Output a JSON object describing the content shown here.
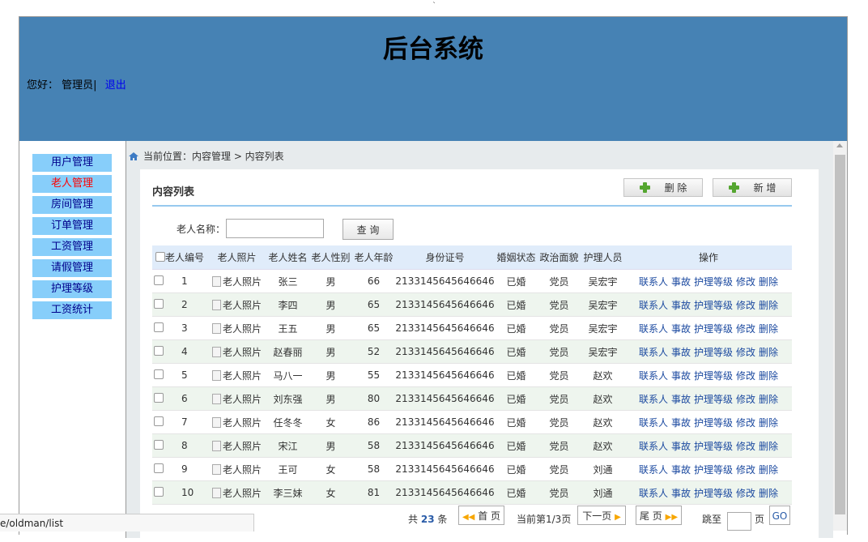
{
  "window_tick": "`",
  "header": {
    "title": "后台系统",
    "greeting": "您好：",
    "user": "管理员|",
    "logout": "退出"
  },
  "sidebar": {
    "items": [
      {
        "label": "用户管理",
        "active": false
      },
      {
        "label": "老人管理",
        "active": true
      },
      {
        "label": "房间管理",
        "active": false
      },
      {
        "label": "订单管理",
        "active": false
      },
      {
        "label": "工资管理",
        "active": false
      },
      {
        "label": "请假管理",
        "active": false
      },
      {
        "label": "护理等级",
        "active": false
      },
      {
        "label": "工资统计",
        "active": false
      }
    ]
  },
  "breadcrumb": "当前位置：内容管理 > 内容列表",
  "panel": {
    "title": "内容列表",
    "delete_label": "删 除",
    "add_label": "新 增"
  },
  "search": {
    "label": "老人名称：",
    "value": "",
    "button": "查 询"
  },
  "table": {
    "headers": [
      "老人编号",
      "老人照片",
      "老人姓名",
      "老人性别",
      "老人年龄",
      "身份证号",
      "婚姻状态",
      "政治面貌",
      "护理人员",
      "操作"
    ],
    "photo_alt": "老人照片",
    "actions": [
      "联系人",
      "事故",
      "护理等级",
      "修改",
      "删除"
    ],
    "rows": [
      {
        "id": "1",
        "name": "张三",
        "gender": "男",
        "age": "66",
        "idcard": "2133145645646646",
        "marital": "已婚",
        "political": "党员",
        "nurse": "吴宏宇"
      },
      {
        "id": "2",
        "name": "李四",
        "gender": "男",
        "age": "65",
        "idcard": "2133145645646646",
        "marital": "已婚",
        "political": "党员",
        "nurse": "吴宏宇"
      },
      {
        "id": "3",
        "name": "王五",
        "gender": "男",
        "age": "65",
        "idcard": "2133145645646646",
        "marital": "已婚",
        "political": "党员",
        "nurse": "吴宏宇"
      },
      {
        "id": "4",
        "name": "赵春丽",
        "gender": "男",
        "age": "52",
        "idcard": "2133145645646646",
        "marital": "已婚",
        "political": "党员",
        "nurse": "吴宏宇"
      },
      {
        "id": "5",
        "name": "马八一",
        "gender": "男",
        "age": "55",
        "idcard": "2133145645646646",
        "marital": "已婚",
        "political": "党员",
        "nurse": "赵欢"
      },
      {
        "id": "6",
        "name": "刘东强",
        "gender": "男",
        "age": "80",
        "idcard": "2133145645646646",
        "marital": "已婚",
        "political": "党员",
        "nurse": "赵欢"
      },
      {
        "id": "7",
        "name": "任冬冬",
        "gender": "女",
        "age": "86",
        "idcard": "2133145645646646",
        "marital": "已婚",
        "political": "党员",
        "nurse": "赵欢"
      },
      {
        "id": "8",
        "name": "宋江",
        "gender": "男",
        "age": "58",
        "idcard": "2133145645646646",
        "marital": "已婚",
        "political": "党员",
        "nurse": "赵欢"
      },
      {
        "id": "9",
        "name": "王可",
        "gender": "女",
        "age": "58",
        "idcard": "2133145645646646",
        "marital": "已婚",
        "political": "党员",
        "nurse": "刘通"
      },
      {
        "id": "10",
        "name": "李三妹",
        "gender": "女",
        "age": "81",
        "idcard": "2133145645646646",
        "marital": "已婚",
        "political": "党员",
        "nurse": "刘通"
      }
    ]
  },
  "pager": {
    "total_prefix": "共",
    "total": "23",
    "total_suffix": "条",
    "first": "首 页",
    "current": "当前第1/3页",
    "next": "下一页",
    "last": "尾 页",
    "jump_prefix": "跳至",
    "jump_suffix": "页",
    "go": "GO"
  },
  "status_url": "e/oldman/list"
}
